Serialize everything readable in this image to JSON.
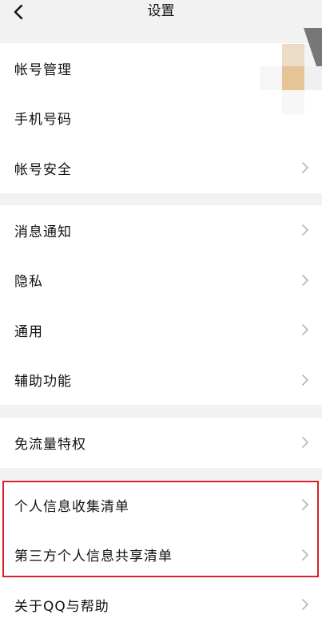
{
  "nav": {
    "title": "设置"
  },
  "groups": [
    {
      "items": [
        {
          "label": "帐号管理",
          "chevron": false
        },
        {
          "label": "手机号码",
          "chevron": false
        },
        {
          "label": "帐号安全",
          "chevron": true
        }
      ]
    },
    {
      "items": [
        {
          "label": "消息通知",
          "chevron": true
        },
        {
          "label": "隐私",
          "chevron": true
        },
        {
          "label": "通用",
          "chevron": true
        },
        {
          "label": "辅助功能",
          "chevron": true
        }
      ]
    },
    {
      "items": [
        {
          "label": "免流量特权",
          "chevron": true
        }
      ]
    },
    {
      "items": [
        {
          "label": "个人信息收集清单",
          "chevron": true
        },
        {
          "label": "第三方个人信息共享清单",
          "chevron": true
        },
        {
          "label": "关于QQ与帮助",
          "chevron": true
        }
      ]
    }
  ],
  "colors": {
    "background": "#f2f2f2",
    "row_background": "#ffffff",
    "chevron": "#b5b5b5",
    "highlight_border": "#d61f26"
  }
}
